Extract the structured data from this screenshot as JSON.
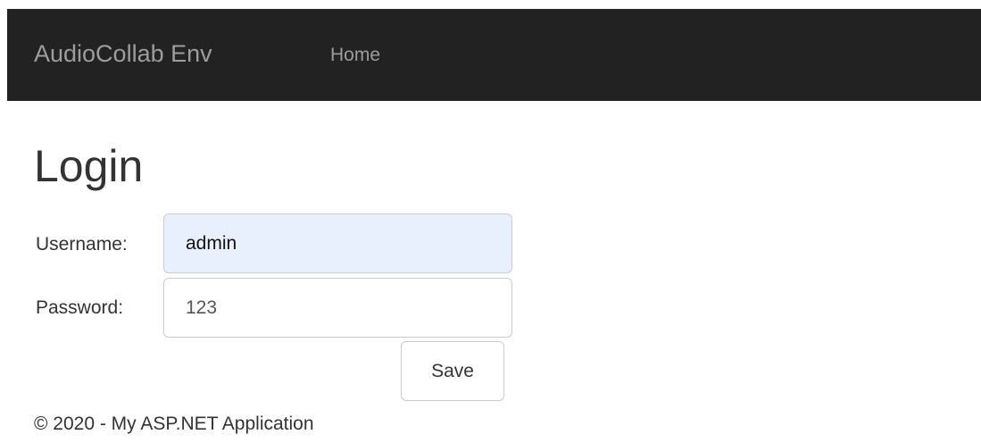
{
  "navbar": {
    "brand": "AudioCollab Env",
    "links": [
      {
        "label": "Home"
      }
    ],
    "background_color": "#222222",
    "text_color": "#9d9d9d"
  },
  "main": {
    "title": "Login",
    "form": {
      "username": {
        "label": "Username:",
        "value": "admin"
      },
      "password": {
        "label": "Password:",
        "value": "123"
      },
      "submit_label": "Save"
    }
  },
  "footer": {
    "text": "© 2020 - My ASP.NET Application"
  }
}
